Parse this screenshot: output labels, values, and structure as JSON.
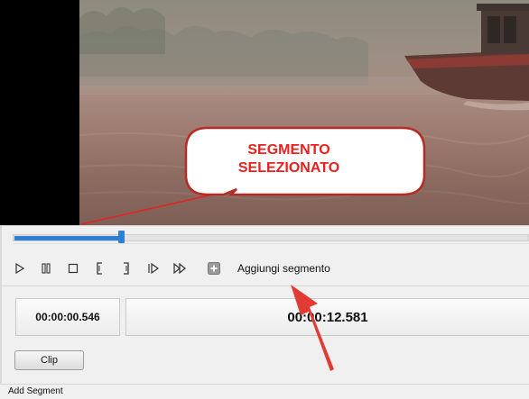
{
  "annotation": {
    "callout_text": "SEGMENTO\nSELEZIONATO",
    "callout_color": "#e8201e"
  },
  "timeline": {
    "selection_color": "#2f7fd3"
  },
  "controls": {
    "play_icon": "play-icon",
    "pause_icon": "pause-icon",
    "stop_icon": "stop-icon",
    "mark_in_icon": "mark-in-icon",
    "mark_out_icon": "mark-out-icon",
    "step_forward_icon": "step-forward-icon",
    "fast_forward_icon": "fast-forward-icon",
    "add_segment_icon": "add-segment-icon",
    "add_segment_label": "Aggiungi segmento"
  },
  "times": {
    "start": "00:00:00.546",
    "end": "00:00:12.581"
  },
  "clip_button_label": "Clip",
  "status_bar": {
    "text": "Add Segment"
  }
}
